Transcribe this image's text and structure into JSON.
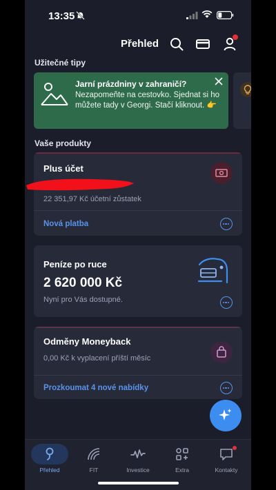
{
  "status_bar": {
    "time": "13:35"
  },
  "header": {
    "title": "Přehled"
  },
  "tips": {
    "section_title": "Užitečné tipy",
    "card": {
      "heading": "Jarní prázdniny v zahraničí?",
      "text": "Nezapomeňte na cestovko. Sjednat si ho můžete tady v Georgi. Stačí kliknout. 👉"
    }
  },
  "products": {
    "section_title": "Vaše produkty",
    "plus": {
      "title": "Plus účet",
      "balance": "22 351,97 Kč účetní zůstatek",
      "link": "Nová platba"
    },
    "loan": {
      "title": "Peníze po ruce",
      "amount": "2 620 000 Kč",
      "sub": "Nyní pro Vás dostupné."
    },
    "moneyback": {
      "title": "Odměny Moneyback",
      "sub": "0,00 Kč k vyplacení příští měsíc",
      "link": "Prozkoumat 4 nové nabídky"
    }
  },
  "bottom_nav": [
    {
      "label": "Přehled",
      "icon": "overview-icon",
      "active": true
    },
    {
      "label": "FIT",
      "icon": "fit-icon"
    },
    {
      "label": "Investice",
      "icon": "investment-icon"
    },
    {
      "label": "Extra",
      "icon": "extra-icon"
    },
    {
      "label": "Kontakty",
      "icon": "chat-icon"
    }
  ],
  "colors": {
    "background": "#1b1d2a",
    "card": "#272a39",
    "tip_green": "#2e6b4b",
    "accent_blue": "#5a93ea",
    "fab_blue": "#3d8cf0",
    "notification_red": "#e2303a"
  }
}
